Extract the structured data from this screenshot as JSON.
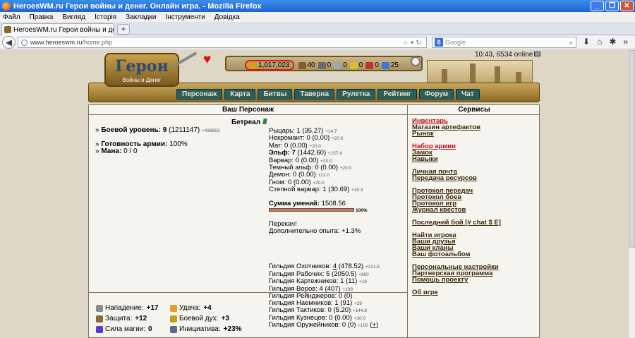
{
  "window": {
    "title": "HeroesWM.ru Герои войны и денег. Онлайн игра. - Mozilla Firefox"
  },
  "menu": [
    "Файл",
    "Правка",
    "Вигляд",
    "Історія",
    "Закладки",
    "Інструменти",
    "Довідка"
  ],
  "tab": {
    "label": "HeroesWM.ru Герои войны и денег. Онла...",
    "close": "×",
    "new": "+"
  },
  "url": {
    "host": "www.heroeswm.ru",
    "path": "/home.php",
    "search_placeholder": "Google"
  },
  "header": {
    "logo_word": "Герои",
    "logo_sub": "Войны и Денег",
    "clock": "10:43, 6534 online",
    "resources": [
      {
        "name": "gold-icon",
        "value": "1,017,023",
        "color": "#d4a01c"
      },
      {
        "name": "wood-icon",
        "value": "40",
        "color": "#8a5a2a"
      },
      {
        "name": "ore-icon",
        "value": "0",
        "color": "#6a6a6a"
      },
      {
        "name": "mercury-icon",
        "value": "0",
        "color": "#9aa8b8"
      },
      {
        "name": "sulfur-icon",
        "value": "0",
        "color": "#d8c020"
      },
      {
        "name": "crystal-icon",
        "value": "0",
        "color": "#c03030"
      },
      {
        "name": "gems-icon",
        "value": "25",
        "color": "#3a7ad8"
      }
    ],
    "nav": [
      "Персонаж",
      "Карта",
      "Битвы",
      "Таверна",
      "Рулетка",
      "Рейтинг",
      "Форум",
      "Чат"
    ]
  },
  "character": {
    "heading": "Ваш Персонаж",
    "name": "Бетреал",
    "level_label": "Боевой уровень:",
    "level": "9",
    "level_exp": "(1211147)",
    "level_small": "+438853",
    "ready_label": "Готовность армии:",
    "ready": "100%",
    "mana_label": "Мана:",
    "mana": "0 / 0",
    "factions": [
      {
        "label": "Рыцарь: 1 (35.27)",
        "small": "+14.7",
        "bold": false
      },
      {
        "label": "Некромант: 0 (0.00)",
        "small": "+20.0",
        "bold": false
      },
      {
        "label": "Маг: 0 (0.00)",
        "small": "+20.0",
        "bold": false
      },
      {
        "label": "Эльф: 7",
        "rest": "(1442.60)",
        "small": "+157.4",
        "bold": true
      },
      {
        "label": "Варвар: 0 (0.00)",
        "small": "+20.0",
        "bold": false
      },
      {
        "label": "Темный эльф: 0 (0.00)",
        "small": "+20.0",
        "bold": false
      },
      {
        "label": "Демон: 0 (0.00)",
        "small": "+22.0",
        "bold": false
      },
      {
        "label": "Гном: 0 (0.00)",
        "small": "+20.0",
        "bold": false
      },
      {
        "label": "Степной варвар: 1 (30.69)",
        "small": "+19.3",
        "bold": false
      }
    ],
    "skills_label": "Сумма умений:",
    "skills_value": "1508.56",
    "skills_pct": "100%",
    "skills_fraction": 1.0,
    "perekach": "Перекач!",
    "extra_exp": "Дополнительно опыта: +1.3%",
    "guilds": [
      {
        "pre": "Гильдия Охотников: ",
        "link": "4",
        "post": " (478.52)",
        "small": "+221.5"
      },
      {
        "pre": "Гильдия Рабочих: 5 (2050.5)",
        "link": "",
        "post": "",
        "small": "+950"
      },
      {
        "pre": "Гильдия Картежников: 1 (11)",
        "link": "",
        "post": "",
        "small": "+19"
      },
      {
        "pre": "Гильдия Воров: 4 (407)",
        "link": "",
        "post": "",
        "small": "+193"
      },
      {
        "pre": "Гильдия Рейнджеров: 0 (0)",
        "link": "",
        "post": "",
        "small": ""
      },
      {
        "pre": "Гильдия Наемников: 1 (91)",
        "link": "",
        "post": "",
        "small": "+29"
      },
      {
        "pre": "Гильдия Тактиков: 0 (5.20)",
        "link": "",
        "post": "",
        "small": "+144.8"
      },
      {
        "pre": "Гильдия Кузнецов: 0 (0.00)",
        "link": "",
        "post": "",
        "small": "+30.0"
      },
      {
        "pre": "Гильдия Оружейников: 0 (0)",
        "link": "",
        "post": "",
        "small": "+100",
        "extra": "(+)"
      }
    ],
    "battle": [
      {
        "icon": "attack-icon",
        "label": "Нападение:",
        "value": "+17",
        "color": "#8a8a8a"
      },
      {
        "icon": "luck-icon",
        "label": "Удача:",
        "value": "+4",
        "color": "#e0a030"
      },
      {
        "icon": "defense-icon",
        "label": "Защита:",
        "value": "+12",
        "color": "#8a6a3a"
      },
      {
        "icon": "morale-icon",
        "label": "Боевой дух:",
        "value": "+3",
        "color": "#c0a020"
      },
      {
        "icon": "spellpower-icon",
        "label": "Сила магии:",
        "value": "0",
        "color": "#5a3ad0"
      },
      {
        "icon": "initiative-icon",
        "label": "Инициатива:",
        "value": "+23%",
        "color": "#5a6a8a"
      }
    ]
  },
  "services": {
    "heading": "Сервисы",
    "groups": [
      [
        {
          "label": "Инвентарь",
          "red": true
        },
        {
          "label": "Магазин артефактов",
          "red": false
        },
        {
          "label": "Рынок",
          "red": false
        }
      ],
      [
        {
          "label": "Набор армии",
          "red": true
        },
        {
          "label": "Замок",
          "red": false
        },
        {
          "label": "Навыки",
          "red": false
        }
      ],
      [
        {
          "label": "Личная почта",
          "red": false
        },
        {
          "label": "Передача ресурсов",
          "red": false
        }
      ],
      [
        {
          "label": "Протокол передач",
          "red": false
        },
        {
          "label": "Протокол боев",
          "red": false
        },
        {
          "label": "Протокол игр",
          "red": false
        },
        {
          "label": "Журнал квестов",
          "red": false
        }
      ],
      [
        {
          "label": "Последний бой [# chat $ E]",
          "red": false
        }
      ],
      [
        {
          "label": "Найти игрока",
          "red": false
        },
        {
          "label": "Ваши друзья",
          "red": false
        },
        {
          "label": "Ваши кланы",
          "red": false
        },
        {
          "label": "Ваш фотоальбом",
          "red": false
        }
      ],
      [
        {
          "label": "Персональные настройки",
          "red": false
        },
        {
          "label": "Партнерская программа",
          "red": false
        },
        {
          "label": "Помощь проекту",
          "red": false
        }
      ],
      [
        {
          "label": "Об игре",
          "red": false
        }
      ]
    ]
  }
}
